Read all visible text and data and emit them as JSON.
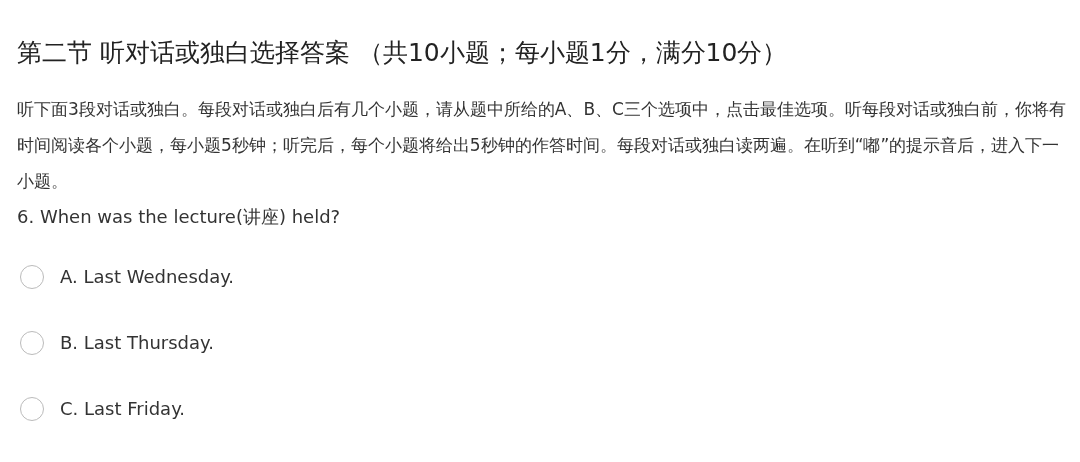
{
  "section_title": "第二节 听对话或独白选择答案 （共10小题；每小题1分，满分10分）",
  "instructions": "听下面3段对话或独白。每段对话或独白后有几个小题，请从题中所给的A、B、C三个选项中，点击最佳选项。听每段对话或独白前，你将有时间阅读各个小题，每小题5秒钟；听完后，每个小题将给出5秒钟的作答时间。每段对话或独白读两遍。在听到“嘟”的提示音后，进入下一小题。",
  "question": "6. When was the lecture(讲座) held?",
  "options": [
    {
      "label": "A. Last Wednesday.",
      "selected": false
    },
    {
      "label": "B. Last Thursday.",
      "selected": false
    },
    {
      "label": "C. Last Friday.",
      "selected": false
    }
  ]
}
